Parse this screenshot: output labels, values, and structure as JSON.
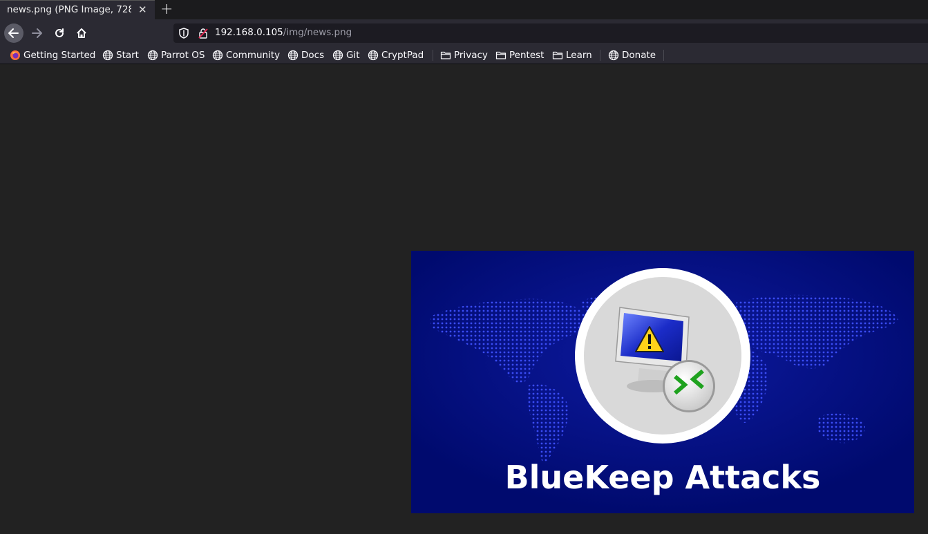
{
  "tab": {
    "title": "news.png (PNG Image, 728",
    "close_icon": "close-icon",
    "new_tab_icon": "plus-icon"
  },
  "nav": {
    "back_icon": "arrow-left-icon",
    "forward_icon": "arrow-right-icon",
    "reload_icon": "reload-icon",
    "home_icon": "home-icon"
  },
  "url": {
    "host": "192.168.0.105",
    "path": "/img/news.png",
    "shield_icon": "shield-icon",
    "insecure_icon": "insecure-lock-icon"
  },
  "bookmarks": [
    {
      "label": "Getting Started",
      "icon": "firefox-icon"
    },
    {
      "label": "Start",
      "icon": "globe-icon"
    },
    {
      "label": "Parrot OS",
      "icon": "globe-icon"
    },
    {
      "label": "Community",
      "icon": "globe-icon"
    },
    {
      "label": "Docs",
      "icon": "globe-icon"
    },
    {
      "label": "Git",
      "icon": "globe-icon"
    },
    {
      "label": "CryptPad",
      "icon": "globe-icon"
    },
    {
      "label": "Privacy",
      "icon": "folder-icon"
    },
    {
      "label": "Pentest",
      "icon": "folder-icon"
    },
    {
      "label": "Learn",
      "icon": "folder-icon"
    },
    {
      "label": "Donate",
      "icon": "globe-icon"
    }
  ],
  "image": {
    "caption": "BlueKeep Attacks",
    "background_color": "#000a6e",
    "dot_color": "#3a4cf5"
  },
  "colors": {
    "toolbar": "#2b2a33",
    "viewer_bg": "#222222",
    "urlbar": "#1c1b22"
  }
}
